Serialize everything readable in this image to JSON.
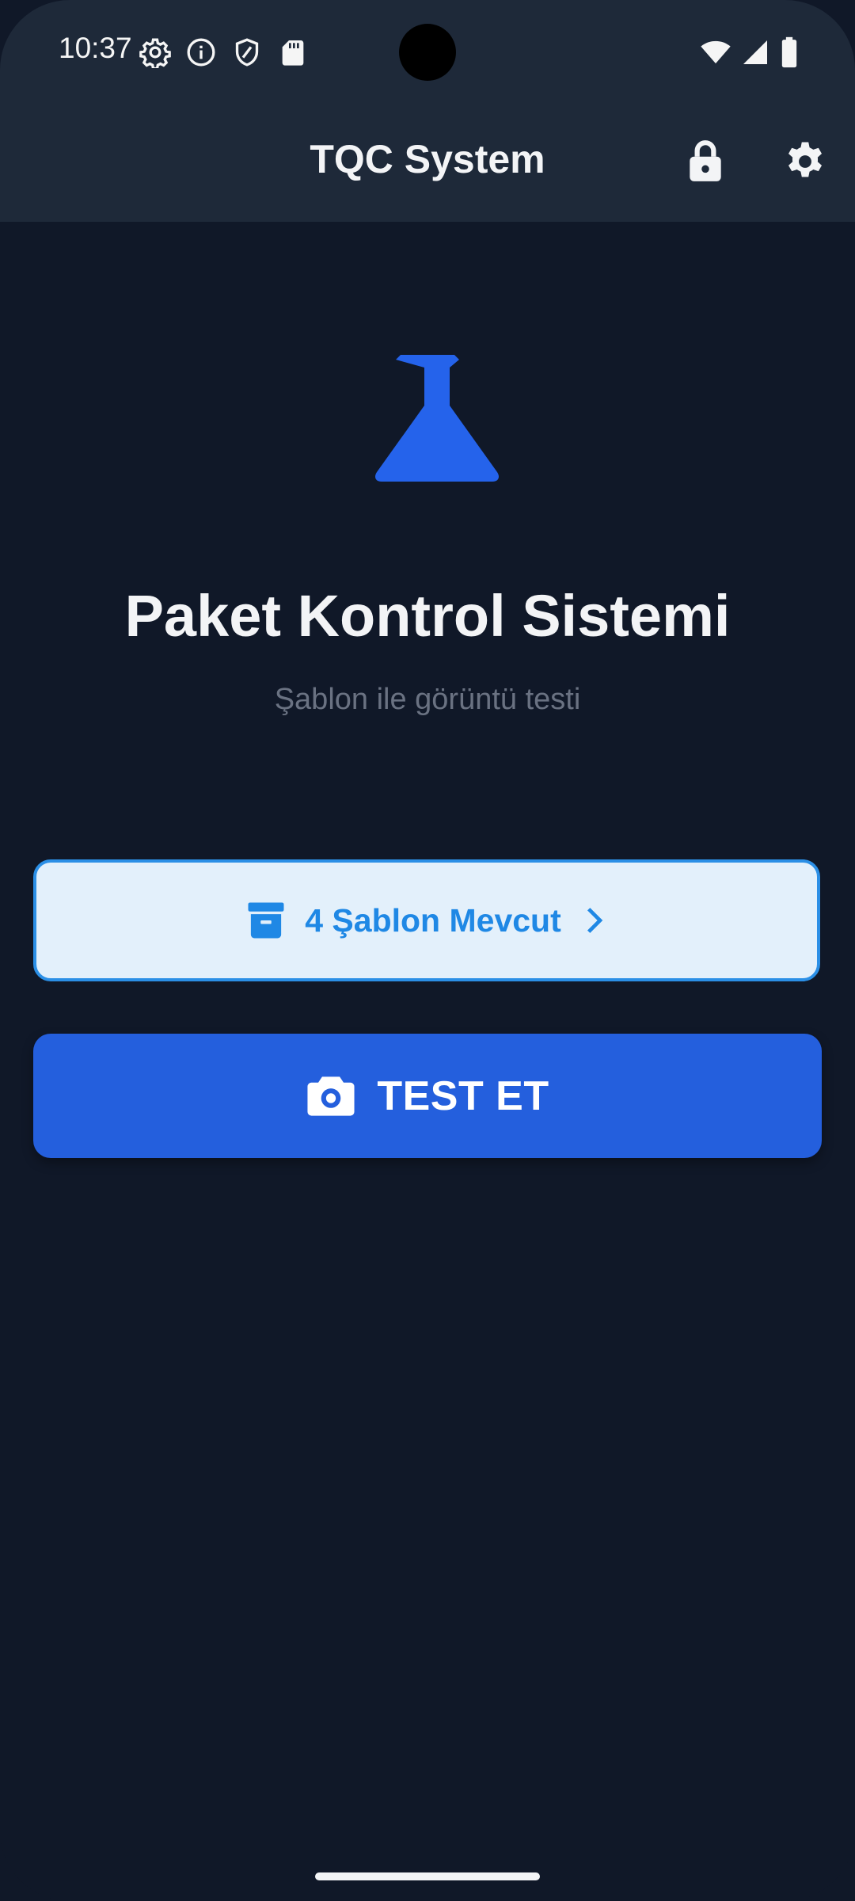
{
  "status_bar": {
    "time": "10:37",
    "left_icons": [
      "settings-gear-icon",
      "info-icon",
      "shield-icon",
      "sd-card-icon"
    ],
    "right_icons": [
      "wifi-icon",
      "cell-signal-icon",
      "battery-icon"
    ]
  },
  "app_bar": {
    "title": "TQC System",
    "actions": [
      "lock-icon",
      "settings-icon"
    ]
  },
  "hero": {
    "icon": "flask-icon",
    "title": "Paket Kontrol Sistemi",
    "subtitle": "Şablon ile görüntü testi"
  },
  "templates_button": {
    "icon": "archive-box-icon",
    "label": "4 Şablon Mevcut",
    "trailing_icon": "chevron-right-icon"
  },
  "test_button": {
    "icon": "camera-icon",
    "label": "TEST ET"
  },
  "colors": {
    "background": "#101828",
    "app_bar": "#1e2939",
    "primary": "#245fdd",
    "templates_bg": "#e3f0fb",
    "templates_accent": "#1f88e5",
    "subtitle": "#6a7282"
  }
}
